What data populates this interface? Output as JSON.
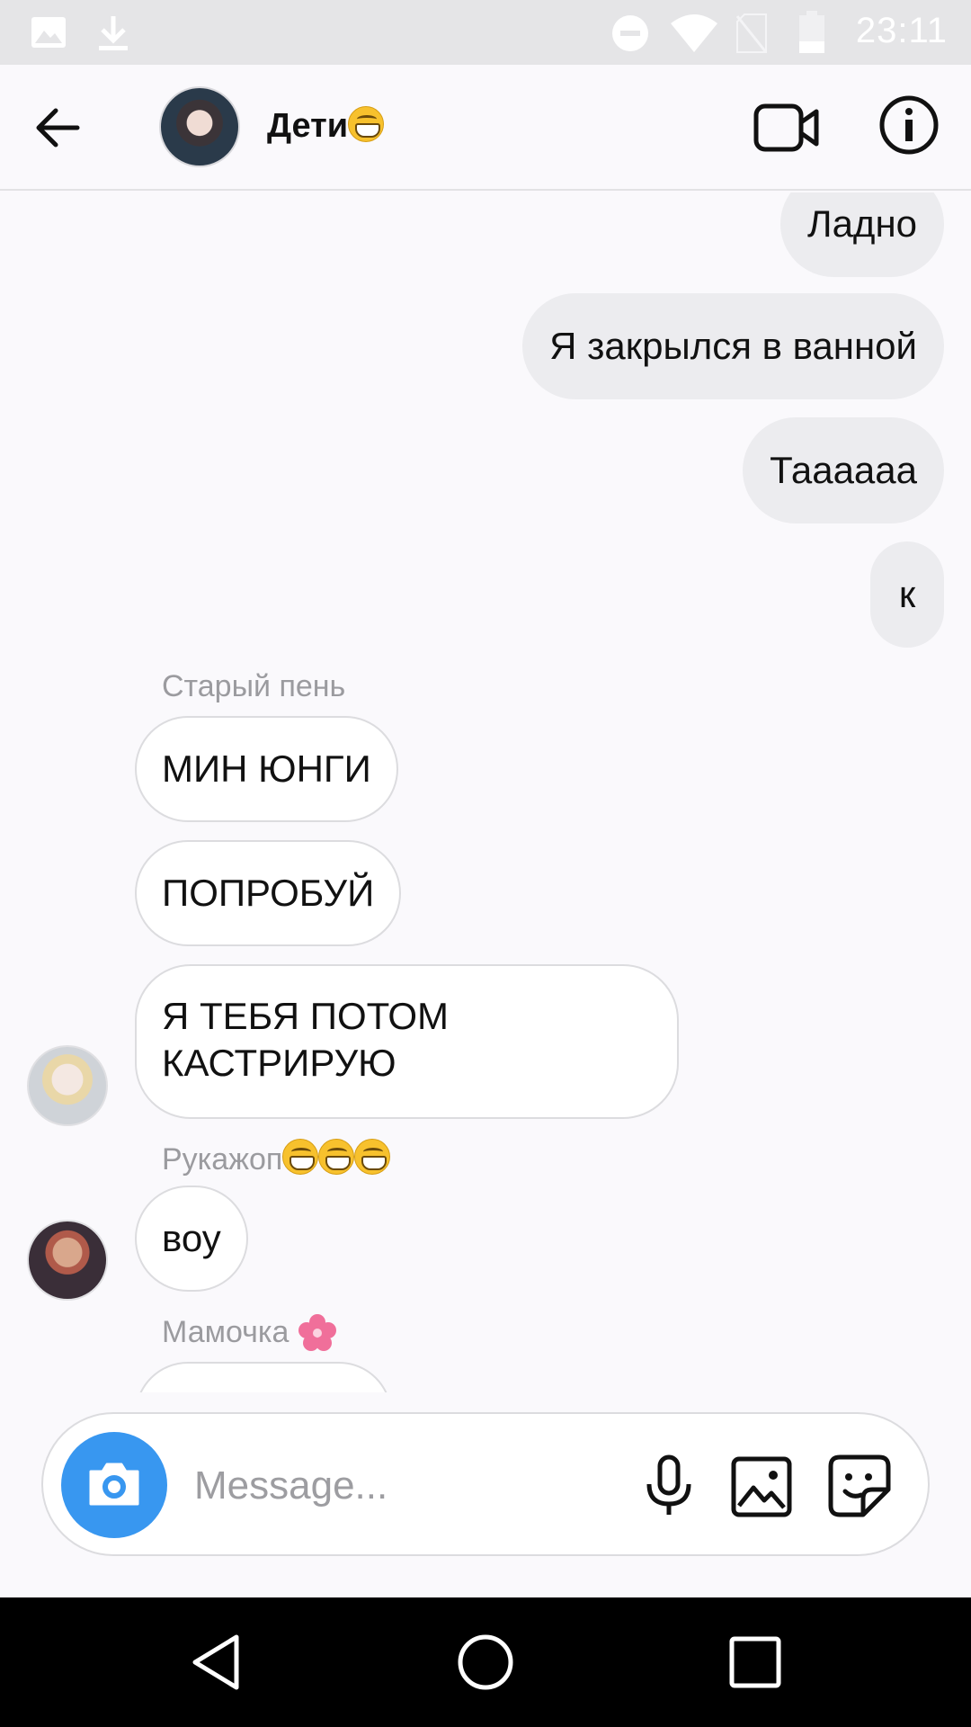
{
  "status_bar": {
    "time": "23:11",
    "icons": [
      "image-icon",
      "download-icon",
      "dnd-icon",
      "wifi-icon",
      "no-sim-icon",
      "battery-icon"
    ]
  },
  "header": {
    "title": "Дети",
    "title_emoji": "grinning-face-emoji",
    "icons": [
      "back-arrow-icon",
      "group-avatar",
      "video-camera-icon",
      "info-icon"
    ]
  },
  "messages": {
    "outgoing": [
      {
        "text": "Ладно"
      },
      {
        "text": "Я закрылся в ванной"
      },
      {
        "text": "Таааааа"
      },
      {
        "text": "к"
      }
    ],
    "group1": {
      "sender": "Старый пень",
      "items": [
        {
          "text": "МИН ЮНГИ"
        },
        {
          "text": "ПОПРОБУЙ"
        },
        {
          "line1": "Я ТЕБЯ ПОТОМ",
          "line2": "КАСТРИРУЮ"
        }
      ]
    },
    "group2": {
      "sender": "Рукажоп",
      "sender_emojis": [
        "grinning-face-emoji",
        "grinning-face-emoji",
        "grinning-face-emoji"
      ],
      "items": [
        {
          "text": "воу"
        }
      ]
    },
    "group3": {
      "sender": "Мамочка",
      "sender_emoji": "cherry-blossom-emoji"
    }
  },
  "composer": {
    "placeholder": "Message...",
    "icons": [
      "camera-icon",
      "microphone-icon",
      "gallery-icon",
      "sticker-icon"
    ]
  },
  "nav_bar": {
    "icons": [
      "nav-back-icon",
      "nav-home-icon",
      "nav-recents-icon"
    ]
  },
  "colors": {
    "accent": "#3897f0",
    "outgoing_bubble": "#ececef",
    "incoming_bubble": "#ffffff",
    "sender_text": "#9b9b9f"
  }
}
